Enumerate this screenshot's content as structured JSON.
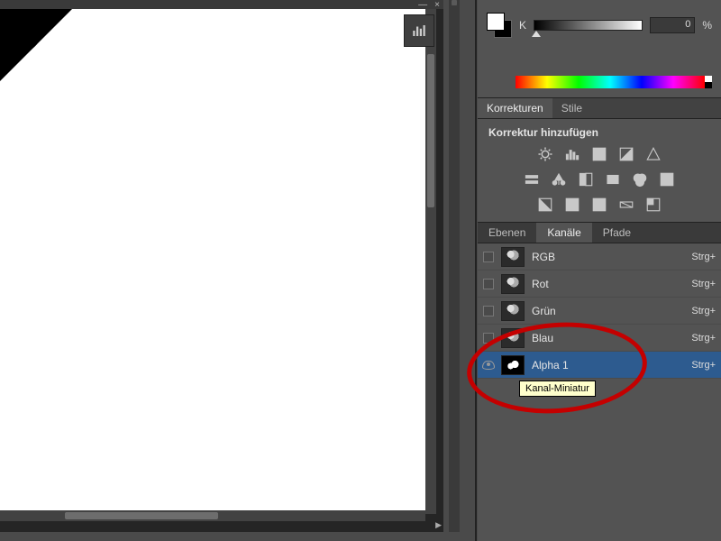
{
  "color": {
    "mode": "K",
    "value": "0",
    "unit": "%"
  },
  "adjustments": {
    "tab_korrekturen": "Korrekturen",
    "tab_stile": "Stile",
    "title": "Korrektur hinzufügen"
  },
  "channels_panel": {
    "tab_ebenen": "Ebenen",
    "tab_kanaele": "Kanäle",
    "tab_pfade": "Pfade"
  },
  "channels": [
    {
      "name": "RGB",
      "shortcut": "Strg+",
      "visible": false,
      "selected": false
    },
    {
      "name": "Rot",
      "shortcut": "Strg+",
      "visible": false,
      "selected": false
    },
    {
      "name": "Grün",
      "shortcut": "Strg+",
      "visible": false,
      "selected": false
    },
    {
      "name": "Blau",
      "shortcut": "Strg+",
      "visible": false,
      "selected": false
    },
    {
      "name": "Alpha 1",
      "shortcut": "Strg+",
      "visible": true,
      "selected": true
    }
  ],
  "tooltip": "Kanal-Miniatur"
}
